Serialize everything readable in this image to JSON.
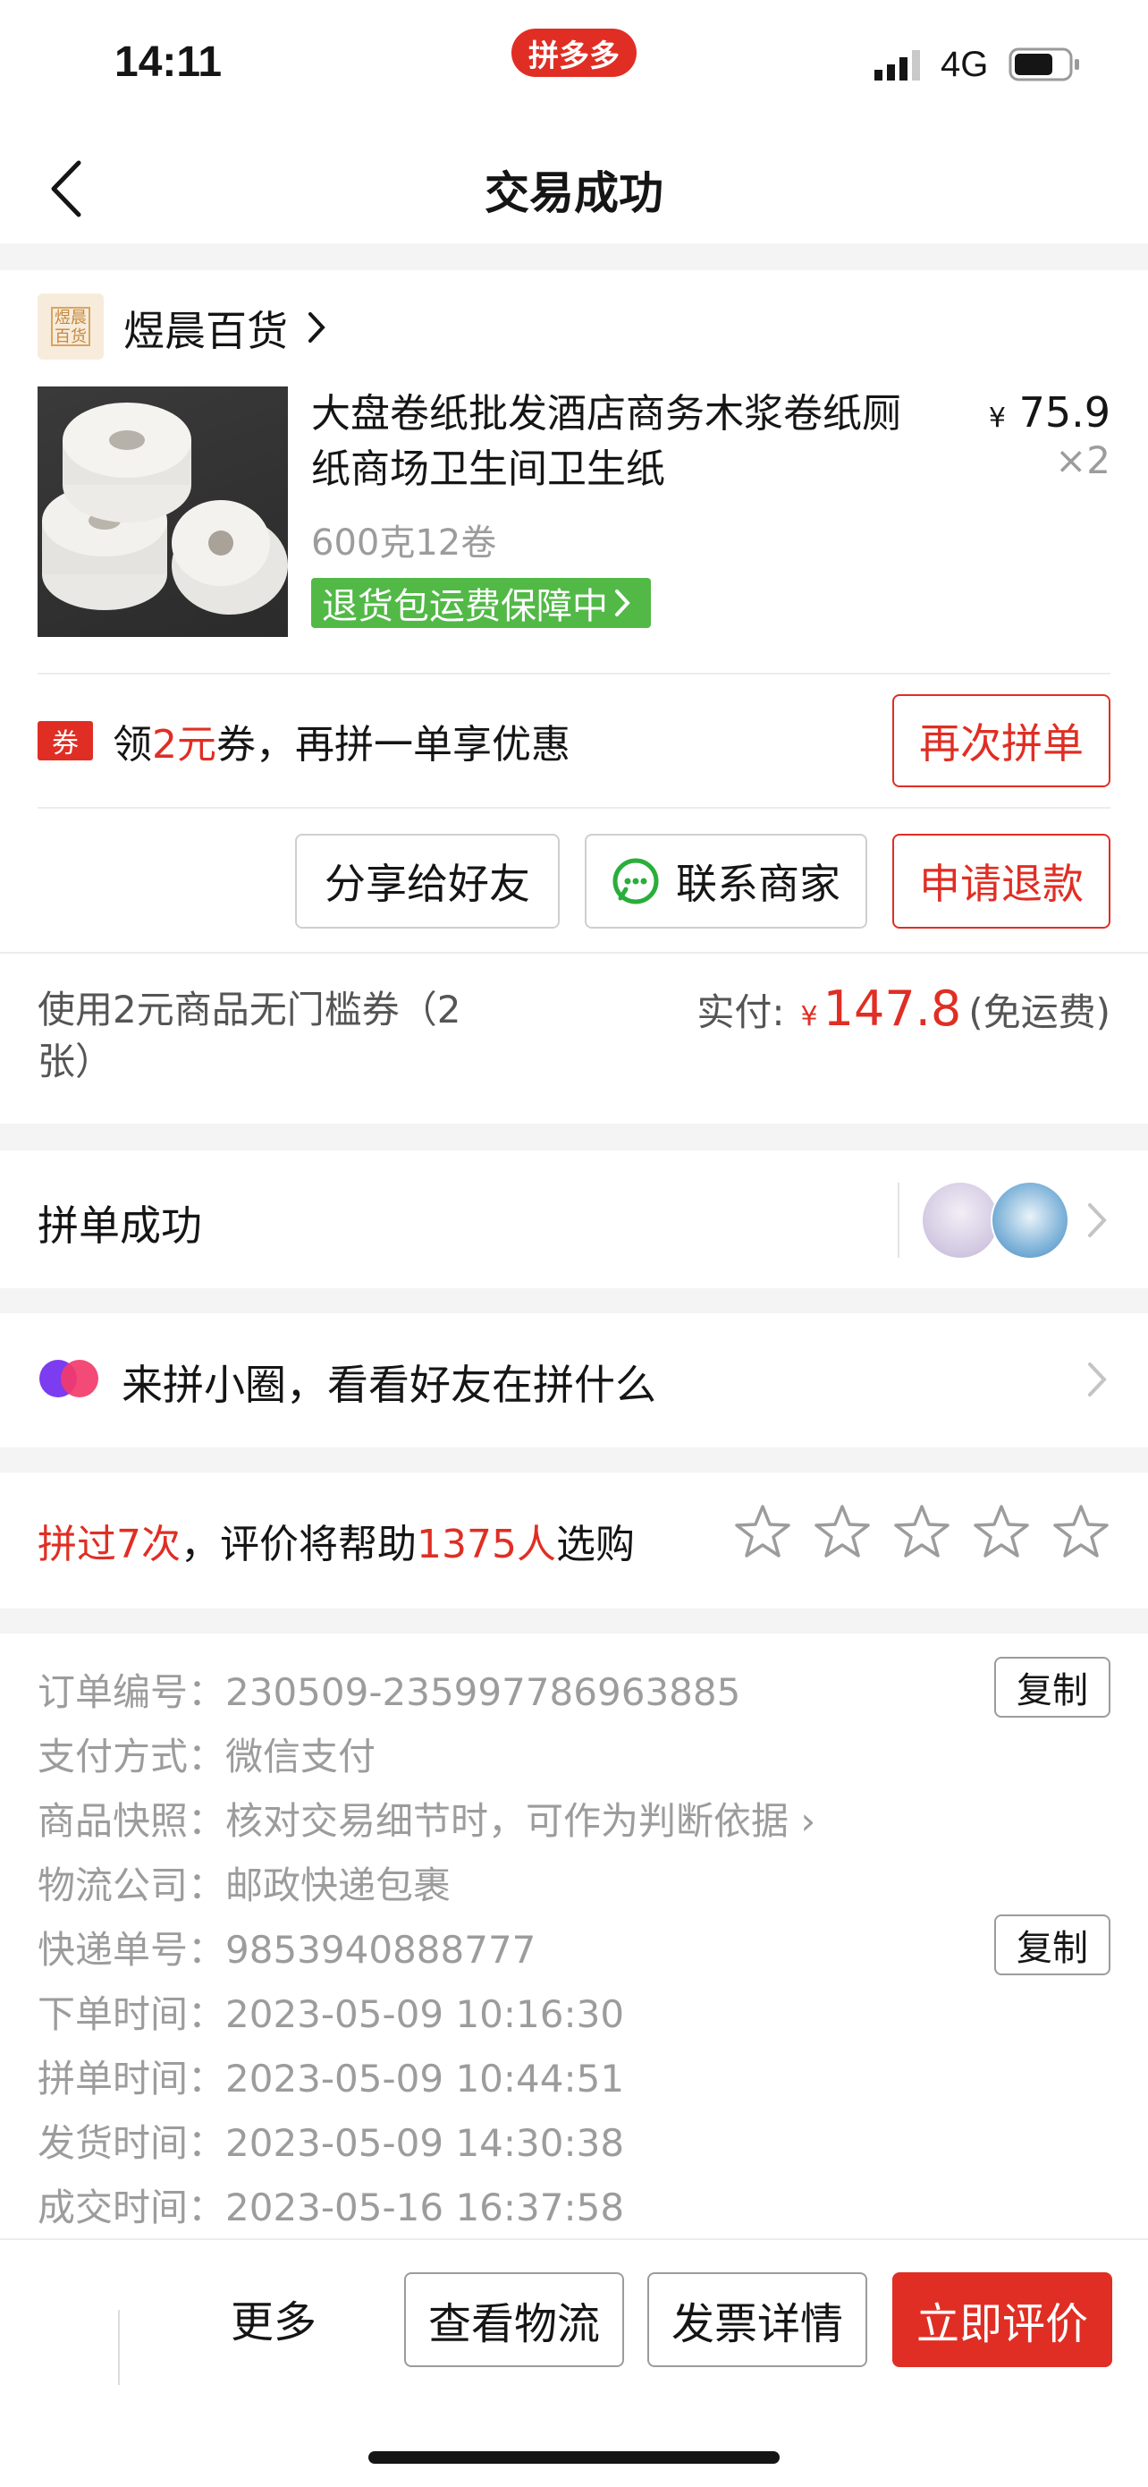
{
  "status_bar": {
    "time": "14:11",
    "app_badge": "拼多多",
    "network": "4G"
  },
  "nav": {
    "title": "交易成功"
  },
  "store": {
    "name": "煜晨百货",
    "logo_text": "煜晨百货"
  },
  "product": {
    "title": "大盘卷纸批发酒店商务木浆卷纸厕纸商场卫生间卫生纸",
    "title_line1": "大盘卷纸批发酒店商务木浆卷纸厕",
    "title_line2": "纸商场卫生间卫生纸",
    "spec": "600克12卷",
    "badge": "退货包运费保障中",
    "currency": "¥",
    "price": "75.9",
    "quantity": "×2"
  },
  "coupon": {
    "tag": "券",
    "text_pre": "领",
    "amount": "2元",
    "text_post": "券，再拼一单享优惠",
    "button": "再次拼单"
  },
  "actions": {
    "share": "分享给好友",
    "contact": "联系商家",
    "refund": "申请退款"
  },
  "payment": {
    "coupon_note_line1": "使用2元商品无门槛券（2",
    "coupon_note_line2": "张）",
    "paid_label": "实付:",
    "currency": "¥",
    "amount": "147.8",
    "shipping": "(免运费)"
  },
  "group": {
    "label": "拼单成功"
  },
  "circle": {
    "label": "来拼小圈，看看好友在拼什么"
  },
  "review": {
    "times": "拼过7次",
    "text_mid": "，评价将帮助",
    "people": "1375人",
    "text_end": "选购",
    "rating": 0,
    "max_stars": 5
  },
  "order_info": {
    "copy_label": "复制",
    "rows": [
      {
        "label": "订单编号：",
        "value": "230509-235997786963885"
      },
      {
        "label": "支付方式：",
        "value": "微信支付"
      },
      {
        "label": "商品快照：",
        "value": "核对交易细节时，可作为判断依据 ›"
      },
      {
        "label": "物流公司：",
        "value": "邮政快递包裹"
      },
      {
        "label": "快递单号：",
        "value": "9853940888777"
      },
      {
        "label": "下单时间：",
        "value": "2023-05-09 10:16:30"
      },
      {
        "label": "拼单时间：",
        "value": "2023-05-09 10:44:51"
      },
      {
        "label": "发货时间：",
        "value": "2023-05-09 14:30:38"
      },
      {
        "label": "成交时间：",
        "value": "2023-05-16 16:37:58"
      }
    ]
  },
  "bottom_bar": {
    "more": "更多",
    "logistics": "查看物流",
    "invoice": "发票详情",
    "review_now": "立即评价"
  },
  "colors": {
    "accent": "#e02e24",
    "green_badge": "#52b947",
    "wechat_green": "#2aae3a"
  }
}
